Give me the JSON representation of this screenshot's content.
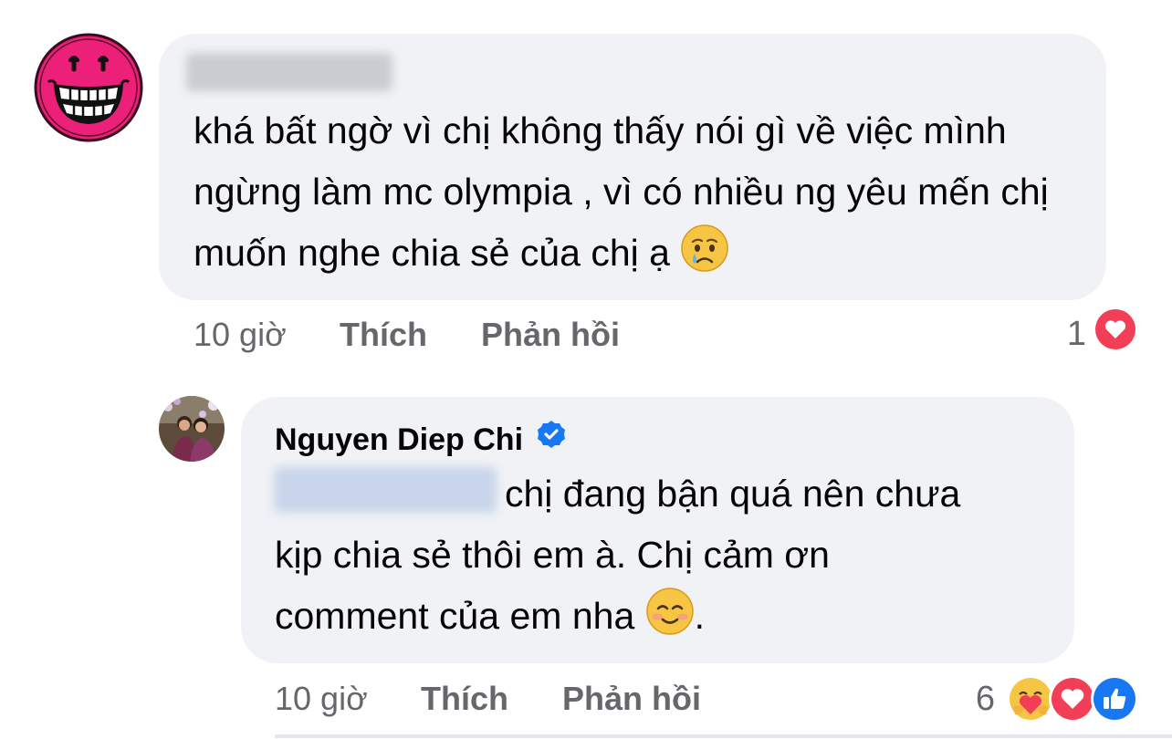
{
  "comments": [
    {
      "author": "",
      "text": "khá bất ngờ vì chị không thấy nói gì về việc mình ngừng làm mc olympia , vì có nhiều ng yêu mến chị muốn nghe chia sẻ của chị ạ",
      "emoji": "crying-face",
      "time": "10 giờ",
      "like_label": "Thích",
      "reply_label": "Phản hồi",
      "reaction_count": "1",
      "reactions": [
        "love"
      ]
    },
    {
      "author": "Nguyen Diep Chi",
      "verified": true,
      "text_line1": "chị đang bận quá nên chưa",
      "text_line2": "kịp chia sẻ thôi em à. Chị cảm ơn",
      "text_line3": "comment của em nha",
      "text_end": ".",
      "emoji": "smiling-face",
      "time": "10 giờ",
      "like_label": "Thích",
      "reply_label": "Phản hồi",
      "reaction_count": "6",
      "reactions": [
        "care",
        "love",
        "like"
      ]
    }
  ],
  "colors": {
    "bubble": "#f0f2f5",
    "meta_text": "#65676b",
    "love": "#f33e58",
    "like": "#1877f2",
    "avatar_pink": "#ec1f79"
  }
}
